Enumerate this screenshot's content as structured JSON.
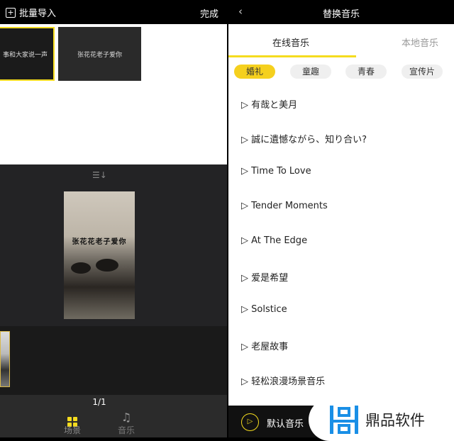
{
  "left": {
    "header": {
      "import_label": "批量导入",
      "done_label": "完成"
    },
    "scenes": [
      "事和大家说一声",
      "张花花老子爱你"
    ],
    "preview_caption": "张花花老子爱你",
    "page": "1/1",
    "nav": [
      {
        "label": "场景",
        "icon": "grid-icon",
        "active": true
      },
      {
        "label": "音乐",
        "icon": "music-note-icon",
        "active": false
      }
    ]
  },
  "right": {
    "header": {
      "title": "替换音乐"
    },
    "tabs": [
      {
        "label": "在线音乐",
        "active": true
      },
      {
        "label": "本地音乐",
        "active": false
      }
    ],
    "categories": [
      {
        "label": "婚礼",
        "active": true
      },
      {
        "label": "童趣"
      },
      {
        "label": "青春"
      },
      {
        "label": "宣传片"
      }
    ],
    "songs": [
      "有哉と美月",
      "誠に遺憾ながら、知り合い?",
      "Time To Love",
      "Tender Moments",
      "At The Edge",
      "爱是希望",
      "Solstice",
      "老屋故事",
      "轻松浪漫场景音乐"
    ],
    "default_music": "默认音乐"
  },
  "watermark": "鼎品软件",
  "colors": {
    "accent": "#f5dc1e",
    "watermark_blue": "#1a8fe6"
  }
}
